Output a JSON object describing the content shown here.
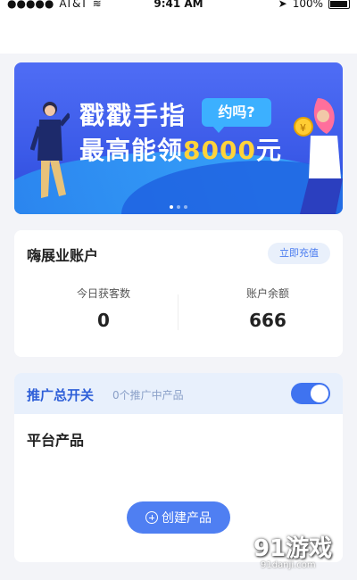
{
  "status_bar": {
    "carrier": "AT&T",
    "time": "9:41 AM",
    "battery": "100%"
  },
  "banner": {
    "line1": "戳戳手指",
    "line2_prefix": "最高能领",
    "line2_amount": "8000",
    "line2_suffix": "元",
    "bubble": "约吗?",
    "watermark": "91游戏",
    "page_count": 3,
    "active_page": 1
  },
  "account": {
    "title": "嗨展业账户",
    "recharge_label": "立即充值",
    "today_customers_label": "今日获客数",
    "today_customers_value": "0",
    "balance_label": "账户余额",
    "balance_value": "666"
  },
  "promotion": {
    "title": "推广总开关",
    "subtitle": "0个推广中产品",
    "toggle_on": true,
    "platform_title": "平台产品",
    "create_label": "创建产品"
  },
  "watermark": {
    "text": "91游戏",
    "url": "91danji.com"
  },
  "colors": {
    "accent": "#4f7ff2",
    "banner_amount": "#ffd33a",
    "promo_title": "#2e5fd8"
  }
}
